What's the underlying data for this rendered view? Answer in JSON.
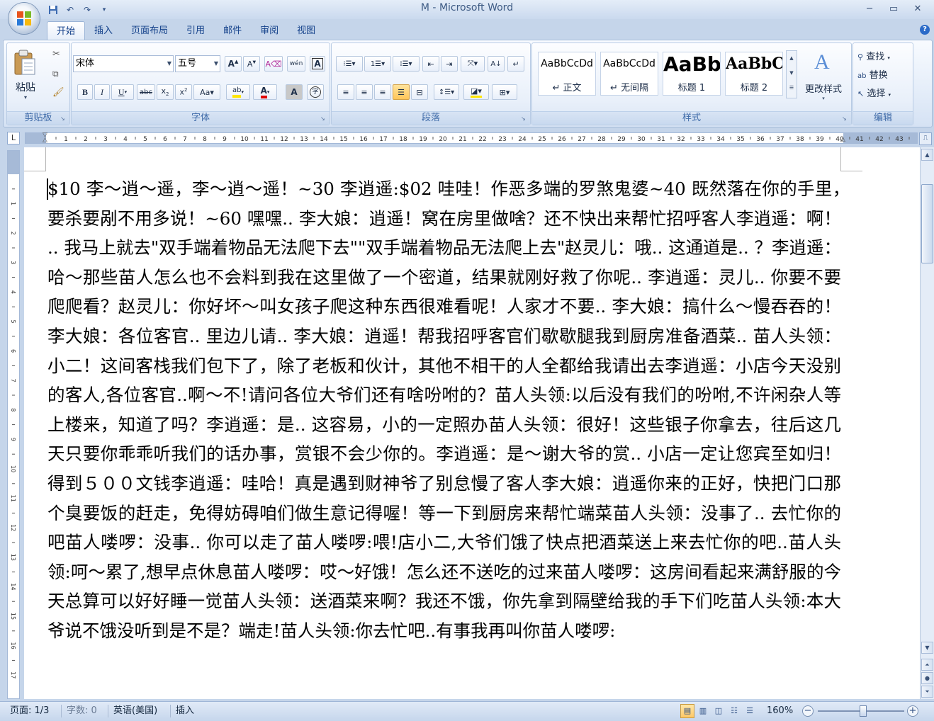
{
  "window": {
    "title": "M - Microsoft Word"
  },
  "tabs": [
    "开始",
    "插入",
    "页面布局",
    "引用",
    "邮件",
    "审阅",
    "视图"
  ],
  "ribbon": {
    "clipboard": {
      "label": "剪贴板",
      "paste_label": "粘贴"
    },
    "font": {
      "label": "字体",
      "font_name": "宋体",
      "font_size": "五号",
      "wen_label": "wén",
      "a_label": "A"
    },
    "paragraph": {
      "label": "段落"
    },
    "styles": {
      "label": "样式",
      "items": [
        {
          "sample": "AaBbCcDd",
          "name": "↵ 正文"
        },
        {
          "sample": "AaBbCcDd",
          "name": "↵ 无间隔"
        },
        {
          "sample": "AaBb",
          "name": "标题 1"
        },
        {
          "sample": "AaBbC",
          "name": "标题 2"
        }
      ],
      "change_styles_label": "更改样式"
    },
    "editing": {
      "label": "编辑",
      "find": "查找",
      "replace": "替换",
      "select": "选择"
    }
  },
  "document": {
    "text": "$10 李～逍～遥，李～逍～遥！~30 李逍遥:$02 哇哇！作恶多端的罗煞鬼婆~40 既然落在你的手里，　 要杀要剐不用多说！~60 嘿嘿.. 李大娘：逍遥！窝在房里做啥？还不快出来帮忙招呼客人李逍遥：啊！　 .. 我马上就去\"双手端着物品无法爬下去\"\"双手端着物品无法爬上去\"赵灵儿：哦.. 这通道是.. ？李逍遥：哈～那些苗人怎么也不会料到我在这里做了一个密道，结果就刚好救了你呢.. 李逍遥：灵儿.. 你要不要爬爬看？赵灵儿：你好坏～叫女孩子爬这种东西很难看呢！人家才不要.. 李大娘：搞什么～慢吞吞的！李大娘：各位客官.. 里边儿请.. 李大娘：逍遥！帮我招呼客官们歇歇腿我到厨房准备酒菜.. 苗人头领：小二！这间客栈我们包下了，除了老板和伙计，其他不相干的人全都给我请出去李逍遥：小店今天没别的客人,各位客官..啊～不!请问各位大爷们还有啥吩咐的？苗人头领:以后没有我们的吩咐,不许闲杂人等上楼来，知道了吗？李逍遥：是.. 这容易，小的一定照办苗人头领：很好！这些银子你拿去，往后这几天只要你乖乖听我们的话办事，赏银不会少你的。李逍遥：是～谢大爷的赏.. 小店一定让您宾至如归！得到５００文钱李逍遥：哇哈！真是遇到财神爷了别怠慢了客人李大娘：逍遥你来的正好，快把门口那个臭要饭的赶走，免得妨碍咱们做生意记得喔！等一下到厨房来帮忙端菜苗人头领：没事了.. 去忙你的吧苗人喽啰：没事.. 你可以走了苗人喽啰:喂!店小二,大爷们饿了快点把酒菜送上来去忙你的吧..苗人头领:呵～累了,想早点休息苗人喽啰：哎～好饿！怎么还不送吃的过来苗人喽啰：这房间看起来满舒服的今天总算可以好好睡一觉苗人头领：送酒菜来啊？我还不饿，你先拿到隔壁给我的手下们吃苗人头领:本大爷说不饿没听到是不是？端走!苗人头领:你去忙吧..有事我再叫你苗人喽啰:"
  },
  "statusbar": {
    "page": "页面: 1/3",
    "words": "字数: 0",
    "language": "英语(美国)",
    "mode": "插入",
    "zoom": "160%"
  },
  "colors": {
    "accent": "#15428b",
    "highlight": "#ffe600",
    "font_color": "#e00000"
  }
}
